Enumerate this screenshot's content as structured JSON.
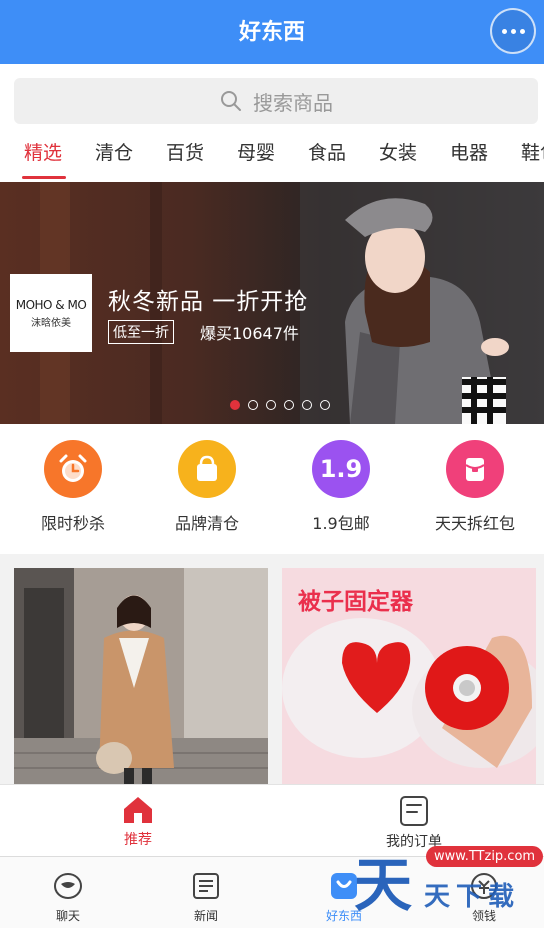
{
  "header": {
    "title": "好东西"
  },
  "search": {
    "placeholder": "搜索商品"
  },
  "tabs": [
    {
      "label": "精选",
      "active": true
    },
    {
      "label": "清仓"
    },
    {
      "label": "百货"
    },
    {
      "label": "母婴"
    },
    {
      "label": "食品"
    },
    {
      "label": "女装"
    },
    {
      "label": "电器"
    },
    {
      "label": "鞋包"
    }
  ],
  "banner": {
    "brand_logo": "MOHO & MO",
    "brand_sub": "沫晗依美",
    "title": "秋冬新品 一折开抢",
    "tag": "低至一折",
    "sold": "爆买10647件",
    "slide_count": 6,
    "active_slide": 1
  },
  "quick": [
    {
      "label": "限时秒杀",
      "icon": "alarm-clock-icon",
      "color": "#f7762a"
    },
    {
      "label": "品牌清仓",
      "icon": "shopping-bag-icon",
      "color": "#f7b21c"
    },
    {
      "label": "1.9包邮",
      "icon": "price-1-9-icon",
      "icon_text": "1.9",
      "color": "#9b52f0"
    },
    {
      "label": "天天拆红包",
      "icon": "red-envelope-icon",
      "color": "#f0407a"
    }
  ],
  "products": [
    {
      "title": "",
      "image": "woman-camel-coat-photo"
    },
    {
      "title": "被子固定器",
      "image": "red-heart-clip-photo"
    }
  ],
  "subnav": [
    {
      "label": "推荐",
      "icon": "home-icon",
      "active": true
    },
    {
      "label": "我的订单",
      "icon": "order-list-icon"
    }
  ],
  "bottomnav": [
    {
      "label": "聊天",
      "icon": "chat-icon"
    },
    {
      "label": "新闻",
      "icon": "news-icon"
    },
    {
      "label": "好东西",
      "icon": "goods-icon",
      "active": true
    },
    {
      "label": "领钱",
      "icon": "wallet-icon"
    }
  ],
  "watermark": {
    "main": "天",
    "url": "www.TTzip.com",
    "rest": "天下载"
  },
  "colors": {
    "brand_blue": "#3e8ef7",
    "accent_red": "#e0323c"
  }
}
